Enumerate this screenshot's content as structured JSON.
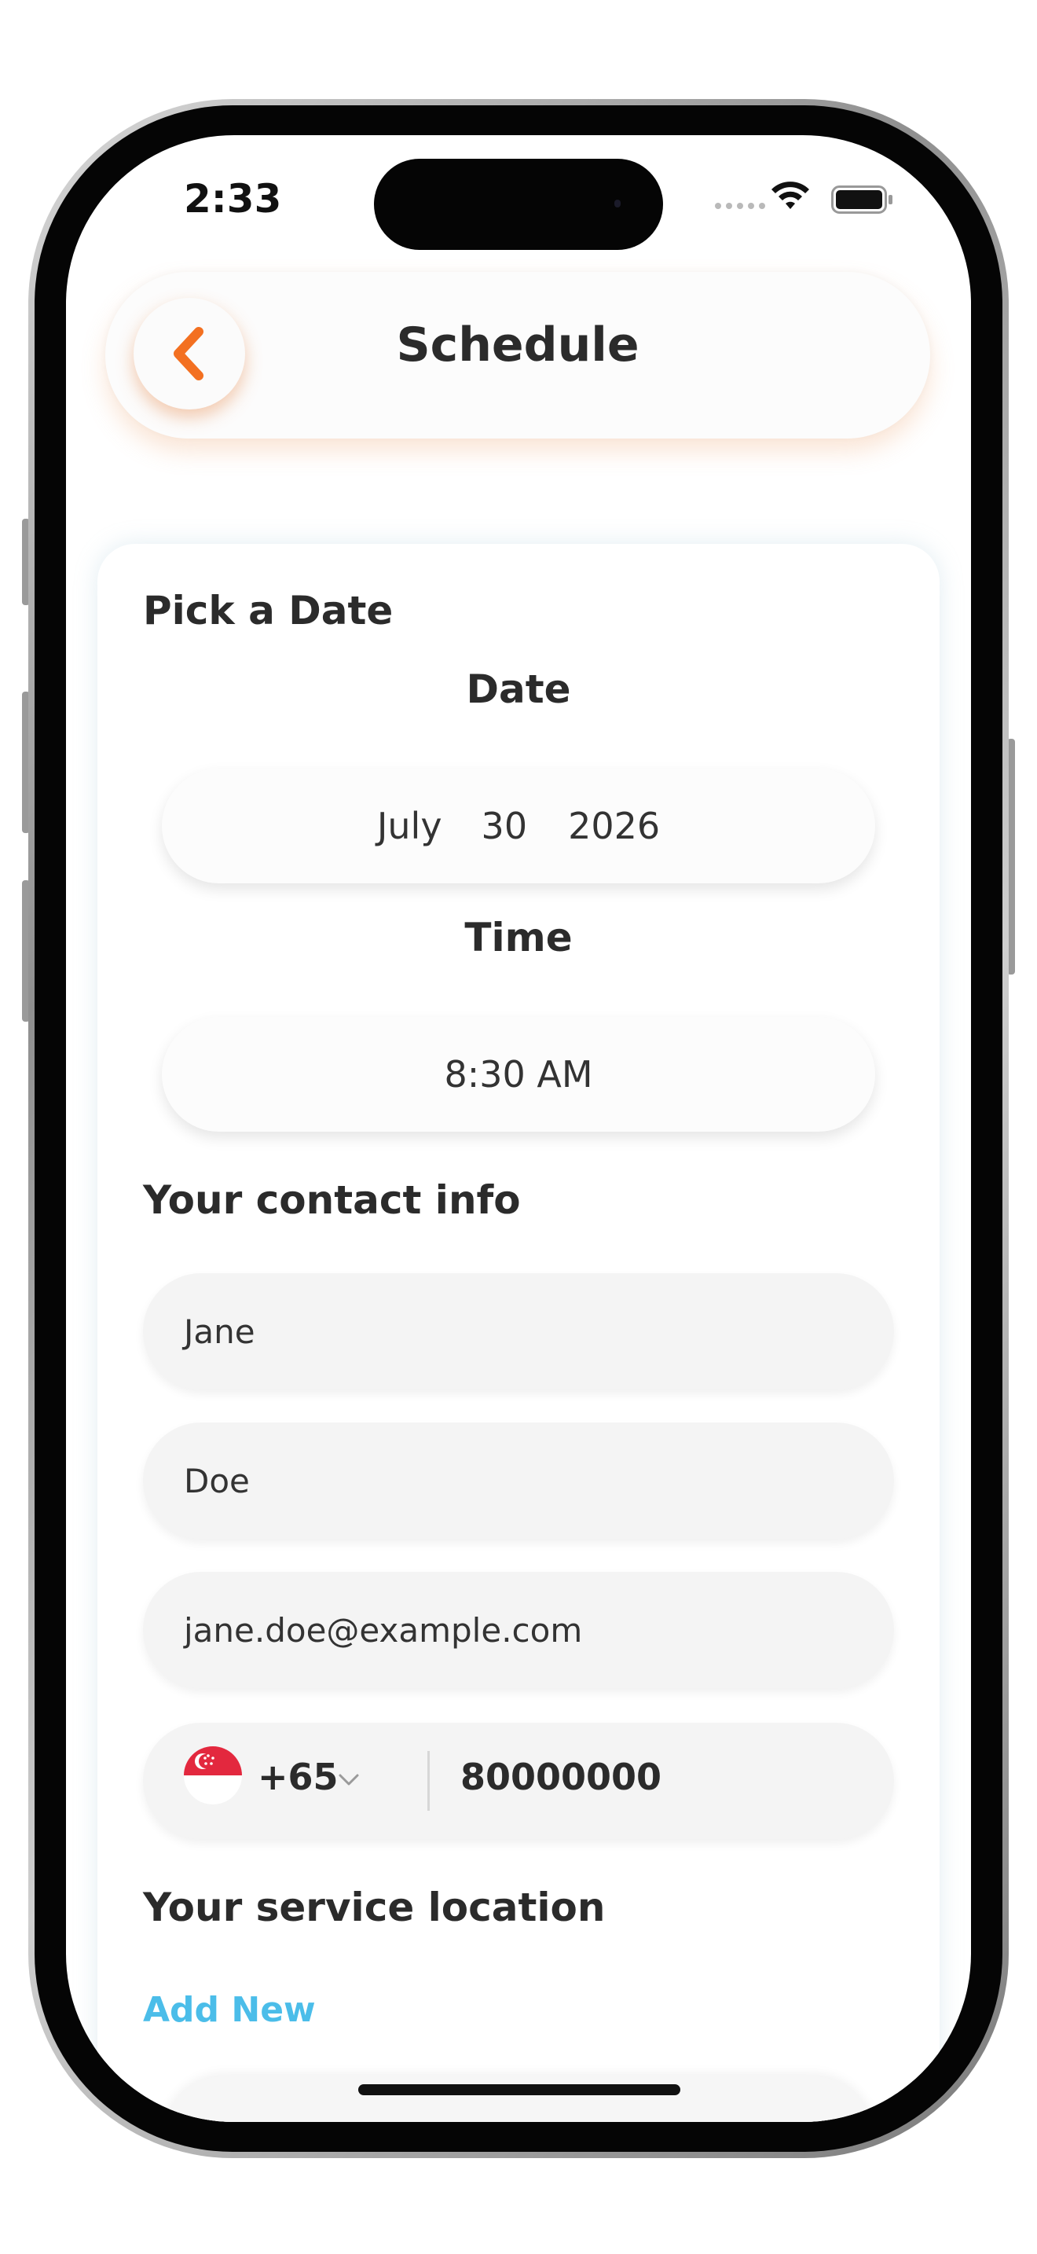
{
  "status_bar": {
    "time": "2:33"
  },
  "header": {
    "title": "Schedule",
    "back_icon": "chevron-left-icon",
    "accent_color": "#f37021"
  },
  "pick_date": {
    "section_title": "Pick a Date",
    "date_caption": "Date",
    "date": {
      "month": "July",
      "day": "30",
      "year": "2026"
    },
    "time_caption": "Time",
    "time": "8:30 AM"
  },
  "contact": {
    "section_title": "Your contact info",
    "first_name": "Jane",
    "last_name": "Doe",
    "email": "jane.doe@example.com",
    "phone": {
      "country_flag": "singapore-flag-icon",
      "dial_code": "+65",
      "number": "80000000"
    }
  },
  "service_location": {
    "section_title": "Your service location",
    "add_new_label": "Add New",
    "link_color": "#4bbde9"
  }
}
